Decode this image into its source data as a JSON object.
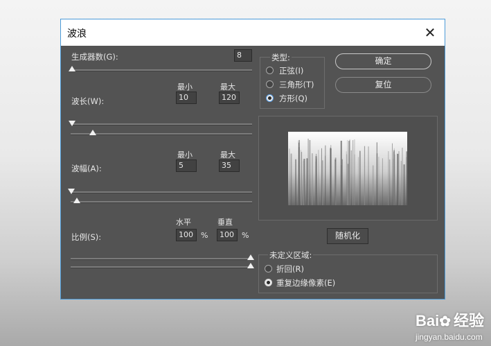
{
  "window": {
    "title": "波浪",
    "close_glyph": "✕"
  },
  "generators": {
    "label": "生成器数(G):",
    "value": "8",
    "level": 0.0
  },
  "wavelength": {
    "label": "波长(W):",
    "min_label": "最小",
    "max_label": "最大",
    "min_value": "10",
    "max_value": "120"
  },
  "amplitude": {
    "label": "波幅(A):",
    "min_label": "最小",
    "max_label": "最大",
    "min_value": "5",
    "max_value": "35"
  },
  "scale": {
    "label": "比例(S):",
    "h_label": "水平",
    "v_label": "垂直",
    "h_value": "100",
    "v_value": "100",
    "unit": "%"
  },
  "type_group": {
    "legend": "类型:",
    "options": [
      {
        "label": "正弦(I)",
        "checked": false
      },
      {
        "label": "三角形(T)",
        "checked": false
      },
      {
        "label": "方形(Q)",
        "checked": true
      }
    ]
  },
  "buttons": {
    "ok": "确定",
    "reset": "复位",
    "randomize": "随机化"
  },
  "undefined_group": {
    "legend": "未定义区域:",
    "options": [
      {
        "label": "折回(R)",
        "checked": false
      },
      {
        "label": "重复边缘像素(E)",
        "checked": true
      }
    ]
  },
  "watermark": {
    "brand": "Bai",
    "brand2": "经验",
    "url": "jingyan.baidu.com"
  },
  "colors": {
    "dialog_bg": "#535353",
    "accent": "#4a9ad8"
  }
}
